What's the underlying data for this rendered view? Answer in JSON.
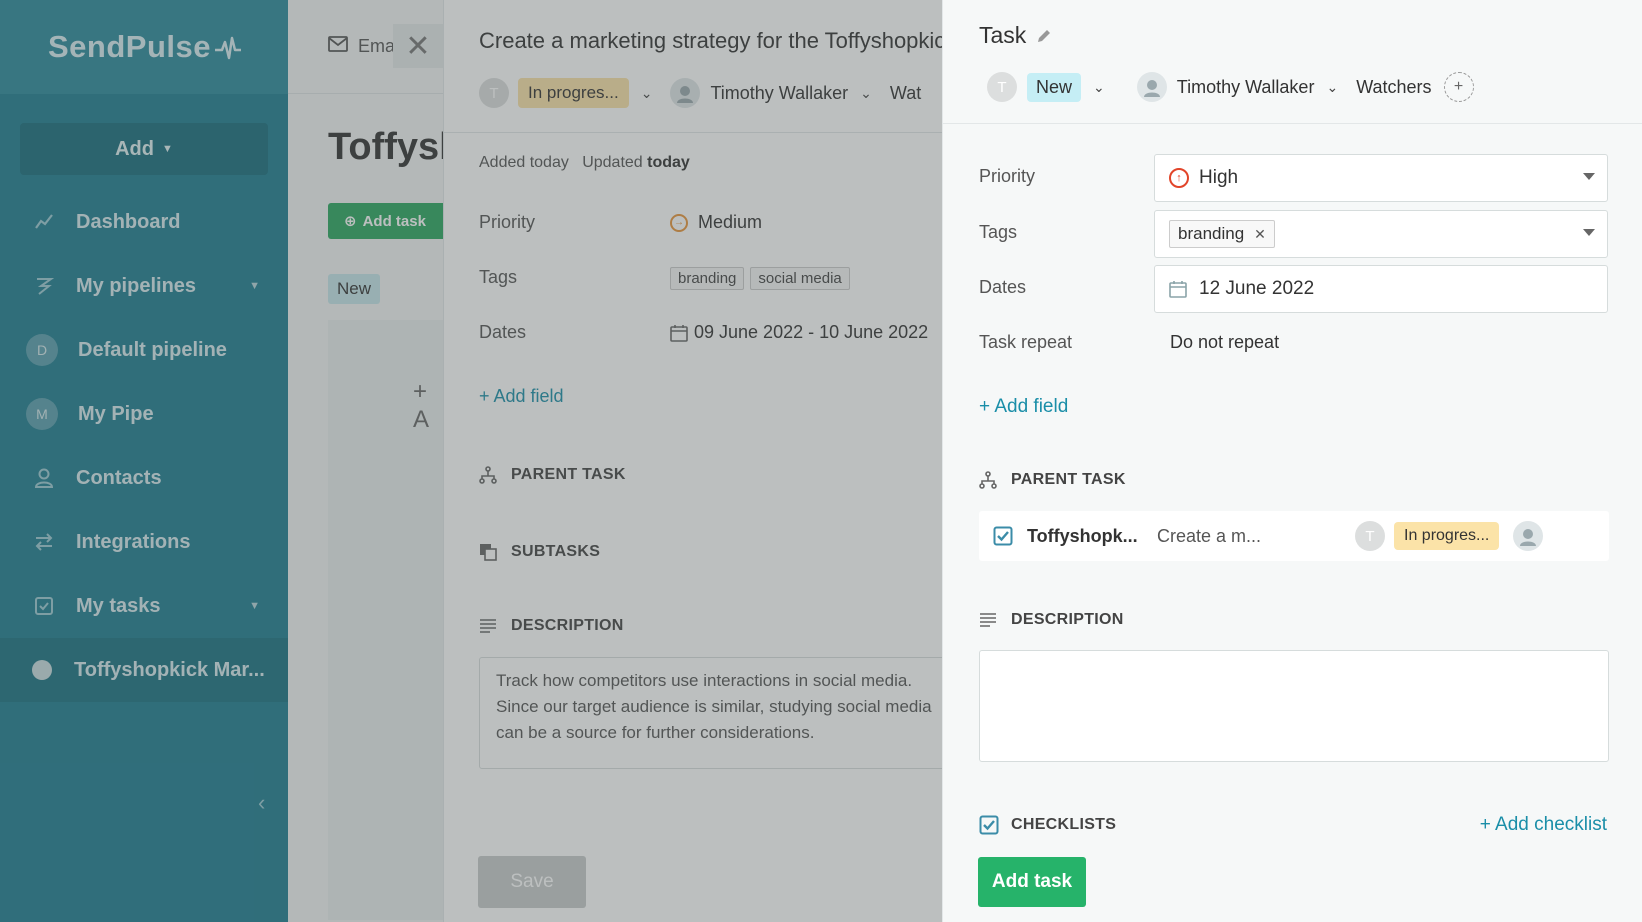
{
  "sidebar": {
    "logo": "SendPulse",
    "add_label": "Add",
    "items": [
      {
        "label": "Dashboard",
        "icon": "dashboard-icon"
      },
      {
        "label": "My pipelines",
        "icon": "pipelines-icon"
      },
      {
        "label": "Default pipeline",
        "avatar": "D"
      },
      {
        "label": "My Pipe",
        "avatar": "M"
      },
      {
        "label": "Contacts",
        "icon": "contacts-icon"
      },
      {
        "label": "Integrations",
        "icon": "integrations-icon"
      },
      {
        "label": "My tasks",
        "icon": "tasks-icon"
      },
      {
        "label": "Toffyshopkick Mar..."
      }
    ]
  },
  "background": {
    "tab_label": "Emai",
    "title": "Toffyshopkick",
    "add_task_label": "Add task",
    "status_new": "New",
    "add_plus": "+ A"
  },
  "middle": {
    "title": "Create a marketing strategy for the Toffyshopkick",
    "assignee_initial": "T",
    "status": "In progres...",
    "owner": "Timothy Wallaker",
    "watchers_cut": "Wat",
    "added": "Added today",
    "updated_prefix": "Updated",
    "updated_value": "today",
    "priority_label": "Priority",
    "priority_value": "Medium",
    "tags_label": "Tags",
    "tags": [
      "branding",
      "social media"
    ],
    "dates_label": "Dates",
    "dates_value": "09 June 2022 - 10 June 2022",
    "add_field": "+ Add field",
    "parent_task": "PARENT TASK",
    "subtasks": "SUBTASKS",
    "description": "DESCRIPTION",
    "desc_lines": [
      "Track how competitors use interactions in social media.",
      "Since our target audience is similar, studying social media",
      "can be a source for further considerations."
    ],
    "save": "Save"
  },
  "right": {
    "title": "Task",
    "assignee_initial": "T",
    "status": "New",
    "owner": "Timothy Wallaker",
    "watchers": "Watchers",
    "watchers_add": "+",
    "priority_label": "Priority",
    "priority_value": "High",
    "tags_label": "Tags",
    "tag": "branding",
    "dates_label": "Dates",
    "dates_value": "12 June 2022",
    "repeat_label": "Task repeat",
    "repeat_value": "Do not repeat",
    "add_field": "+ Add field",
    "parent_task": "PARENT TASK",
    "parent": {
      "name": "Toffyshopk...",
      "desc": "Create a m...",
      "initial": "T",
      "status": "In progres..."
    },
    "description": "DESCRIPTION",
    "checklists": "CHECKLISTS",
    "add_checklist": "+ Add checklist",
    "add_task": "Add task"
  }
}
